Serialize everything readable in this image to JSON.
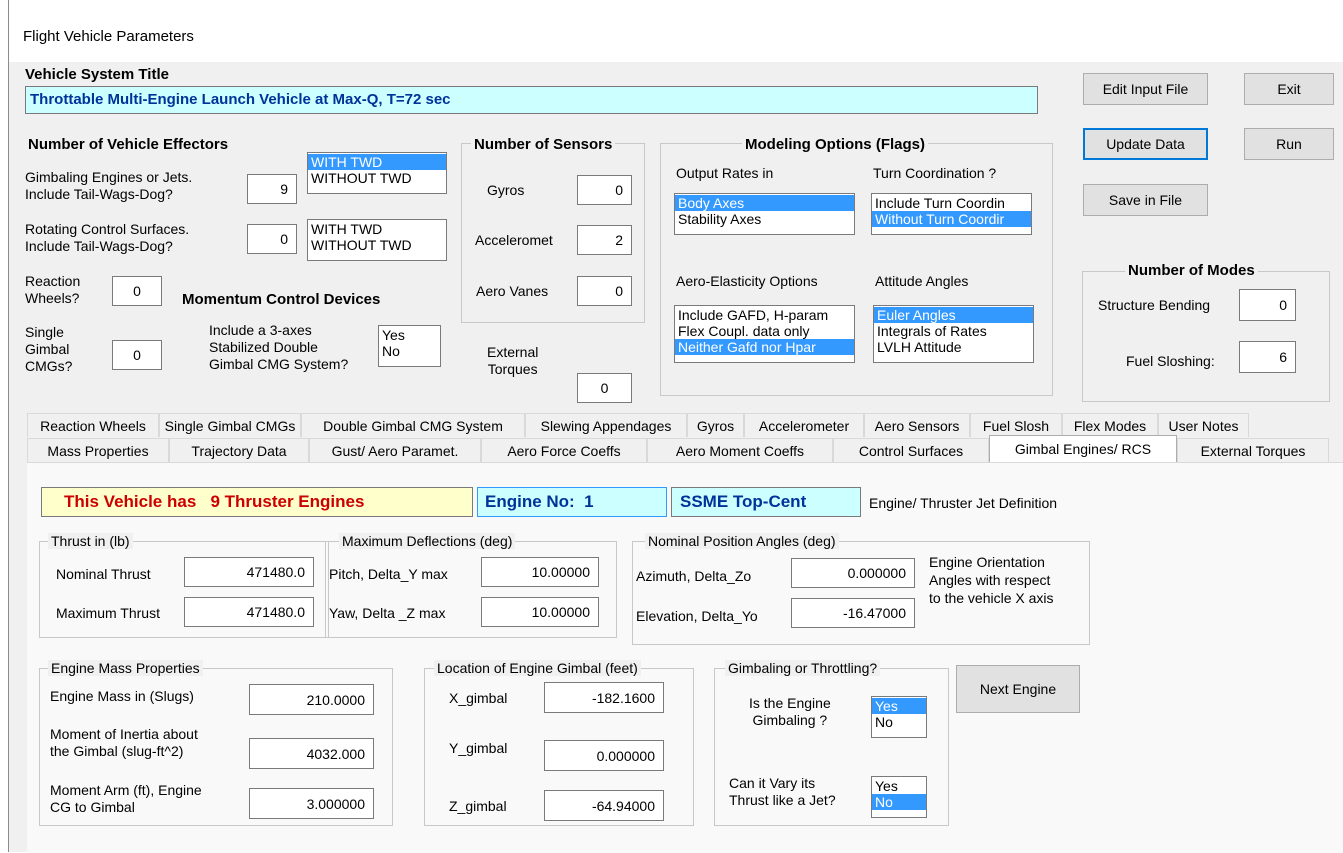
{
  "window": {
    "title": "Flight Vehicle Parameters"
  },
  "vehicle_title": {
    "label": "Vehicle System Title",
    "value": "Throttable Multi-Engine Launch Vehicle at Max-Q, T=72 sec"
  },
  "buttons": {
    "edit_input": "Edit Input File",
    "exit": "Exit",
    "update": "Update Data",
    "run": "Run",
    "save": "Save in File",
    "next_engine": "Next Engine"
  },
  "effectors": {
    "title": "Number of Vehicle Effectors",
    "gimbal_label_1": "Gimbaling Engines or Jets.",
    "gimbal_label_2": "Include Tail-Wags-Dog?",
    "gimbal_value": "9",
    "twd_options": [
      "WITH TWD",
      "WITHOUT TWD"
    ],
    "rot_label_1": "Rotating Control Surfaces.",
    "rot_label_2": "Include Tail-Wags-Dog?",
    "rot_value": "0",
    "rw_label_1": "Reaction",
    "rw_label_2": "Wheels?",
    "rw_value": "0",
    "momentum_title": "Momentum Control Devices",
    "cmg_label_1": "Single",
    "cmg_label_2": "Gimbal",
    "cmg_label_3": "CMGs?",
    "cmg_value": "0",
    "dg_label_1": "Include a 3-axes",
    "dg_label_2": "Stabilized Double",
    "dg_label_3": "Gimbal CMG System?",
    "yes_no": [
      "Yes",
      "No"
    ]
  },
  "sensors": {
    "title": "Number of Sensors",
    "gyros_label": "Gyros",
    "gyros_value": "0",
    "accel_label": "Acceleromet",
    "accel_value": "2",
    "vanes_label": "Aero Vanes",
    "vanes_value": "0",
    "ext_label_1": "External",
    "ext_label_2": "Torques",
    "ext_value": "0"
  },
  "modeling": {
    "title": "Modeling Options (Flags)",
    "rates_label": "Output Rates in",
    "rates_options": [
      "Body Axes",
      "Stability Axes"
    ],
    "turn_label": "Turn Coordination ?",
    "turn_options": [
      "Include Turn Coordin",
      "Without Turn Coordir"
    ],
    "aero_label": "Aero-Elasticity Options",
    "aero_options": [
      "Include GAFD, H-param",
      "Flex Coupl. data only",
      "Neither Gafd nor Hpar"
    ],
    "att_label": "Attitude Angles",
    "att_options": [
      "Euler Angles",
      "Integrals of Rates",
      "LVLH Attitude"
    ]
  },
  "modes": {
    "title": "Number of Modes",
    "bending_label": "Structure Bending",
    "bending_value": "0",
    "slosh_label": "Fuel Sloshing:",
    "slosh_value": "6"
  },
  "tabs_row1": [
    "Reaction Wheels",
    "Single Gimbal CMGs",
    "Double Gimbal CMG System",
    "Slewing Appendages",
    "Gyros",
    "Accelerometer",
    "Aero Sensors",
    "Fuel Slosh",
    "Flex Modes",
    "User Notes"
  ],
  "tabs_row2": [
    "Mass Properties",
    "Trajectory Data",
    "Gust/ Aero Paramet.",
    "Aero Force Coeffs",
    "Aero Moment Coeffs",
    "Control Surfaces",
    "Gimbal Engines/ RCS",
    "External Torques"
  ],
  "engine": {
    "banner": "This Vehicle has   9 Thruster Engines",
    "engine_no": "Engine No:  1",
    "engine_name": "SSME Top-Cent",
    "definition": "Engine/ Thruster Jet Definition",
    "thrust_title": "Thrust in (lb)",
    "nominal_label": "Nominal Thrust",
    "nominal_value": "471480.0",
    "max_label": "Maximum Thrust",
    "max_value": "471480.0",
    "defl_title": "Maximum Deflections (deg)",
    "pitch_label": "Pitch, Delta_Y max",
    "pitch_value": "10.00000",
    "yaw_label": "Yaw, Delta _Z max",
    "yaw_value": "10.00000",
    "pos_title": "Nominal Position Angles (deg)",
    "az_label": "Azimuth, Delta_Zo",
    "az_value": "0.000000",
    "el_label": "Elevation, Delta_Yo",
    "el_value": "-16.47000",
    "orient_1": "Engine Orientation",
    "orient_2": "Angles with respect",
    "orient_3": "to the vehicle  X axis",
    "mass_title": "Engine Mass Properties",
    "mass_label": "Engine Mass in (Slugs)",
    "mass_value": "210.0000",
    "moi_label_1": "Moment of Inertia about",
    "moi_label_2": "the Gimbal (slug-ft^2)",
    "moi_value": "4032.000",
    "arm_label_1": "Moment Arm (ft), Engine",
    "arm_label_2": "CG to Gimbal",
    "arm_value": "3.000000",
    "loc_title": "Location of Engine Gimbal (feet)",
    "x_label": "X_gimbal",
    "x_value": "-182.1600",
    "y_label": "Y_gimbal",
    "y_value": "0.000000",
    "z_label": "Z_gimbal",
    "z_value": "-64.94000",
    "gt_title": "Gimbaling or Throttling?",
    "gimb_q_1": "Is the Engine",
    "gimb_q_2": "Gimbaling ?",
    "thr_q_1": "Can it Vary its",
    "thr_q_2": "Thrust like a Jet?",
    "yes_no": [
      "Yes",
      "No"
    ]
  },
  "colors": {
    "selection": "#3399ff",
    "title_box": "#ccffff",
    "banner_bg": "#ffffcc",
    "banner_text": "#cc0000",
    "engine_text": "#003399"
  }
}
